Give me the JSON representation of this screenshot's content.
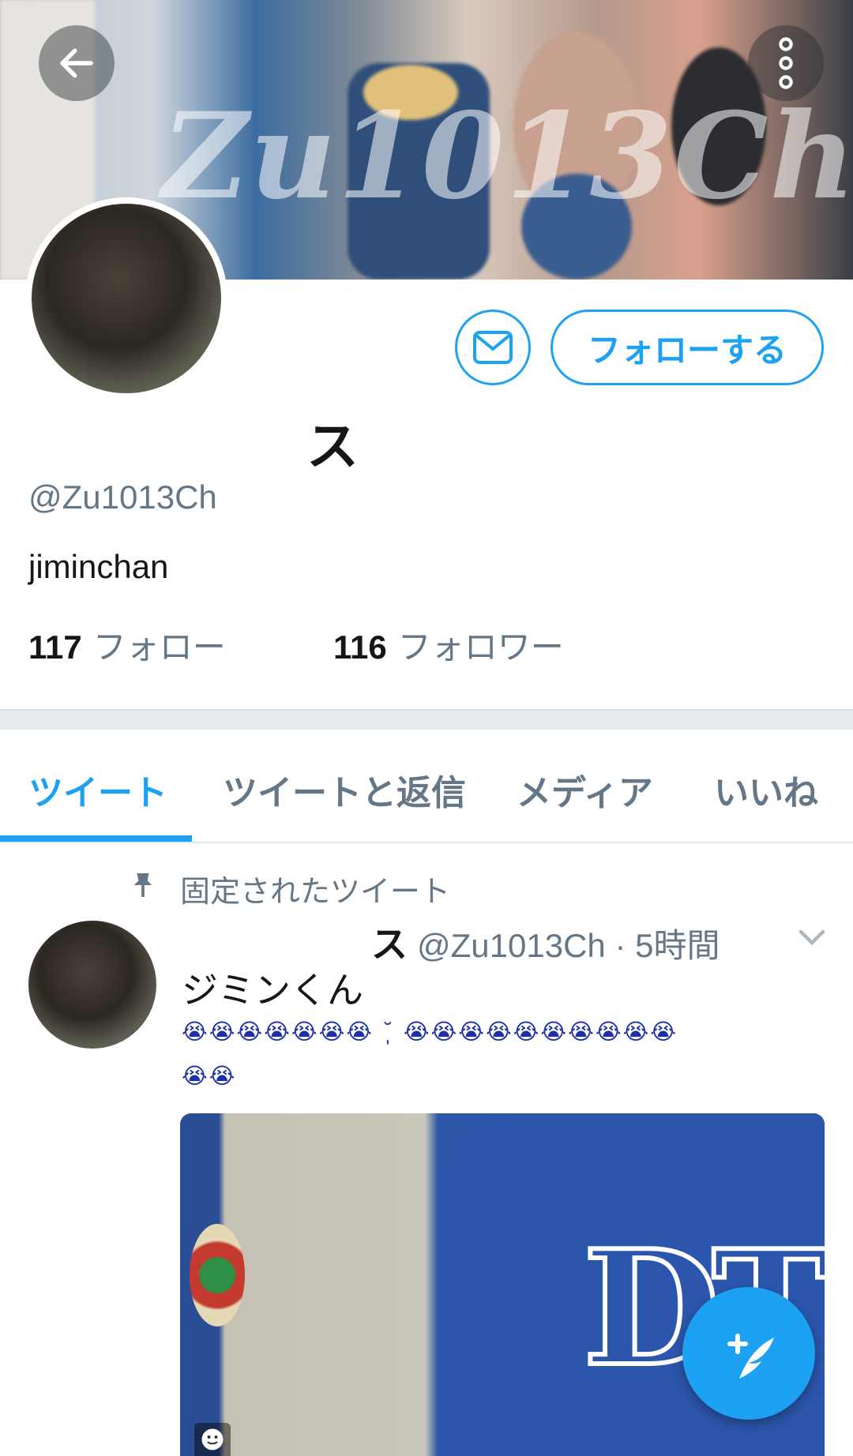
{
  "header": {
    "watermark": "Zu1013Ch",
    "back_icon": "arrow-left-icon",
    "more_icon": "more-vertical-icon"
  },
  "profile": {
    "display_name": "ス",
    "handle": "@Zu1013Ch",
    "bio": "jiminchan",
    "follow_label": "フォローする",
    "dm_icon": "envelope-icon",
    "following_count": "117",
    "following_label": "フォロー",
    "followers_count": "116",
    "followers_label": "フォロワー"
  },
  "tabs": [
    {
      "label": "ツイート",
      "active": true
    },
    {
      "label": "ツイートと返信",
      "active": false
    },
    {
      "label": "メディア",
      "active": false
    },
    {
      "label": "いいね",
      "active": false
    }
  ],
  "pinned_tweet": {
    "pinned_label": "固定されたツイート",
    "name": "ス",
    "meta": "@Zu1013Ch · 5時間",
    "text": "ジミンくん",
    "emoji_line_1": "😭😭😭😭😭😭😭 ˘̩ 😭😭😭😭😭😭😭😭😭😭",
    "emoji_line_2": "😭😭"
  },
  "colors": {
    "accent": "#1da1f2",
    "secondary_text": "#657786",
    "primary_text": "#14171a",
    "separator": "#e6ecf0"
  },
  "fab": {
    "icon": "compose-tweet-icon"
  }
}
